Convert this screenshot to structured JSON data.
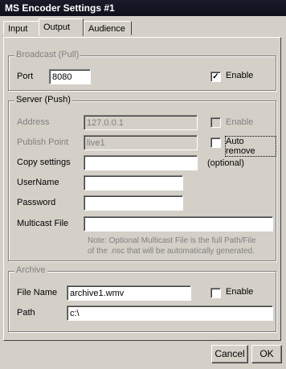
{
  "window": {
    "title": "MS Encoder Settings #1"
  },
  "tabs": [
    {
      "label": "Input"
    },
    {
      "label": "Output"
    },
    {
      "label": "Audience"
    }
  ],
  "broadcast": {
    "legend": "Broadcast (Pull)",
    "port_label": "Port",
    "port_value": "8080",
    "enable_label": "Enable",
    "enable_checked": true
  },
  "server": {
    "legend": "Server (Push)",
    "address_label": "Address",
    "address_value": "127.0.0.1",
    "address_enable_label": "Enable",
    "publish_point_label": "Publish Point",
    "publish_point_value": "live1",
    "auto_remove_label": "Auto remove",
    "copy_settings_label": "Copy settings",
    "copy_settings_value": "",
    "optional_label": "(optional)",
    "username_label": "UserName",
    "username_value": "",
    "password_label": "Password",
    "password_value": "",
    "multicast_label": "Multicast File",
    "multicast_value": "",
    "note_line1": "Note: Optional Multicast File is the full Path/File",
    "note_line2": "of the .nsc that will be automatically generated."
  },
  "archive": {
    "legend": "Archive",
    "file_name_label": "File Name",
    "file_name_value": "archive1.wmv",
    "enable_label": "Enable",
    "path_label": "Path",
    "path_value": "c:\\"
  },
  "buttons": {
    "cancel": "Cancel",
    "ok": "OK"
  },
  "check_mark": "✓"
}
